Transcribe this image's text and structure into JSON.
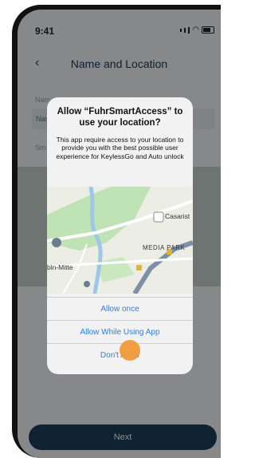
{
  "status_bar": {
    "time": "9:41"
  },
  "header": {
    "title": "Name and Location"
  },
  "background_form": {
    "label_1": "Nam",
    "input_1": "Nam",
    "label_2": "Sm"
  },
  "footer": {
    "next_label": "Next"
  },
  "alert": {
    "title": "Allow “FuhrSmartAccess” to use your location?",
    "message": "This app require access to your location to provide you with the best possible user experience for KeylessGo and Auto unlock",
    "map_labels": {
      "place_1": "Casarist",
      "place_2": "MEDIA PARK",
      "place_3": "bln-Mitte"
    },
    "buttons": {
      "allow_once": "Allow once",
      "allow_while_using": "Allow While Using App",
      "dont_allow": "Don't Allow"
    }
  },
  "colors": {
    "primary": "#1d3e5b",
    "ios_blue": "#2f7fe4",
    "touch_indicator": "#f19a38"
  }
}
